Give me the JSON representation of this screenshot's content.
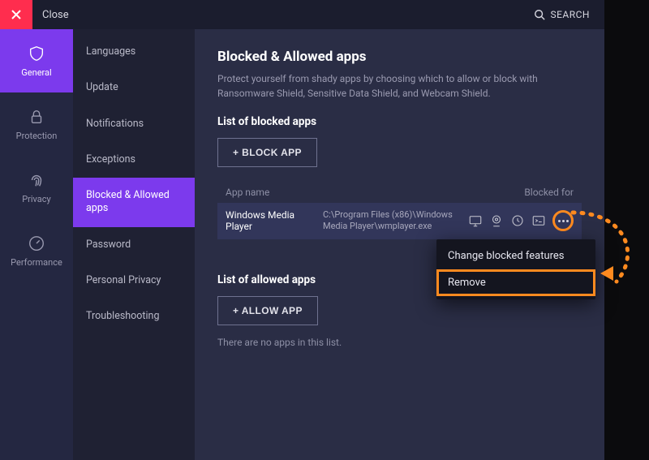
{
  "titlebar": {
    "close_label": "Close",
    "search_label": "SEARCH"
  },
  "rail": {
    "items": [
      {
        "label": "General"
      },
      {
        "label": "Protection"
      },
      {
        "label": "Privacy"
      },
      {
        "label": "Performance"
      }
    ]
  },
  "submenu": {
    "items": [
      {
        "label": "Languages"
      },
      {
        "label": "Update"
      },
      {
        "label": "Notifications"
      },
      {
        "label": "Exceptions"
      },
      {
        "label": "Blocked & Allowed apps"
      },
      {
        "label": "Password"
      },
      {
        "label": "Personal Privacy"
      },
      {
        "label": "Troubleshooting"
      }
    ]
  },
  "main": {
    "title": "Blocked & Allowed apps",
    "description": "Protect yourself from shady apps by choosing which to allow or block with Ransomware Shield, Sensitive Data Shield, and Webcam Shield.",
    "blocked_heading": "List of blocked apps",
    "block_button": "+ BLOCK APP",
    "col_appname": "App name",
    "col_blockedfor": "Blocked for",
    "row": {
      "name": "Windows Media Player",
      "path": "C:\\Program Files (x86)\\Windows Media Player\\wmplayer.exe"
    },
    "allowed_heading": "List of allowed apps",
    "allow_button": "+ ALLOW APP",
    "empty_msg": "There are no apps in this list."
  },
  "context_menu": {
    "item_change": "Change blocked features",
    "item_remove": "Remove"
  }
}
